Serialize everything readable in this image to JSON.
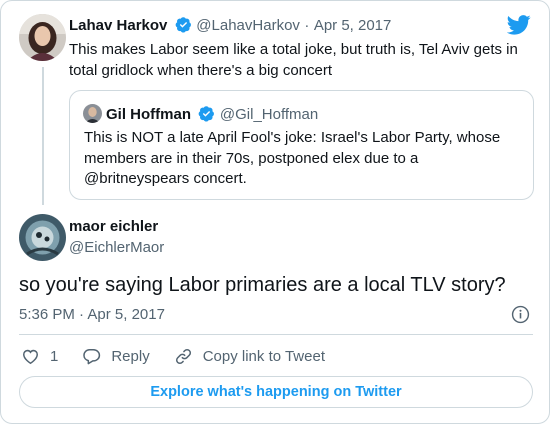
{
  "parent_tweet": {
    "author_name": "Lahav Harkov",
    "handle": "@LahavHarkov",
    "separator": "·",
    "date": "Apr 5, 2017",
    "text": "This makes Labor seem like a total joke, but truth is, Tel Aviv gets in total gridlock when there's a big concert"
  },
  "quoted_tweet": {
    "author_name": "Gil Hoffman",
    "handle": "@Gil_Hoffman",
    "text": "This is NOT a late April Fool's joke: Israel's Labor Party, whose members are in their 70s, postponed elex due to a @britneyspears concert."
  },
  "main_tweet": {
    "author_name": "maor eichler",
    "handle": "@EichlerMaor",
    "text": "so you're saying Labor primaries are a local TLV story?",
    "time": "5:36 PM",
    "separator": "·",
    "date": "Apr 5, 2017"
  },
  "actions": {
    "like_count": "1",
    "reply_label": "Reply",
    "copy_link_label": "Copy link to Tweet"
  },
  "explore_label": "Explore what's happening on Twitter",
  "colors": {
    "accent": "#1d9bf0",
    "text": "#0f1419",
    "muted": "#536471",
    "border": "#cfd9de"
  },
  "icons": [
    "twitter-bird-icon",
    "verified-badge-icon",
    "info-icon",
    "heart-icon",
    "reply-bubble-icon",
    "link-icon"
  ]
}
